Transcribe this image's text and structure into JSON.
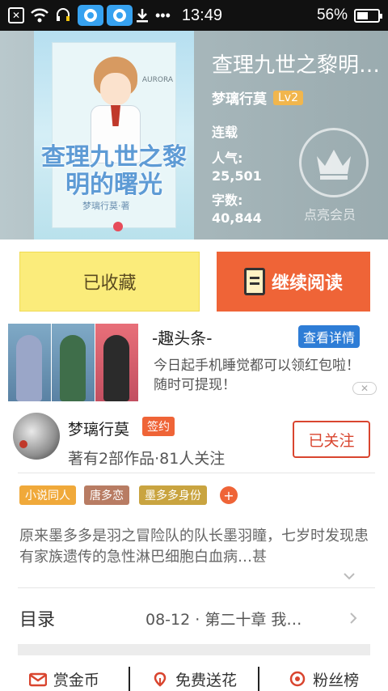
{
  "status_bar": {
    "time": "13:49",
    "battery_percent": "56%",
    "battery_level": 0.56,
    "icons": [
      "sim-blocked-icon",
      "wifi-icon",
      "headset-icon",
      "eye-app-icon",
      "eye-app-icon",
      "download-icon",
      "more-dots-icon"
    ]
  },
  "book": {
    "title": "查理九世之黎明…",
    "cover_title": "查理九世之黎明的曙光",
    "cover_author": "梦璃行莫·著",
    "cover_brand": "AURORA",
    "author": "梦璃行莫",
    "level": "Lv2",
    "status": "连载",
    "popularity_label": "人气:",
    "popularity_value": "25,501",
    "word_count_label": "字数:",
    "word_count_value": "40,844",
    "vip_label": "点亮会员"
  },
  "actions": {
    "favorited": "已收藏",
    "continue_reading": "继续阅读"
  },
  "ad": {
    "title": "-趣头条-",
    "detail_button": "查看详情",
    "description": "今日起手机睡觉都可以领红包啦！随时可提现！",
    "close": "✕"
  },
  "author_card": {
    "name": "梦璃行莫",
    "badge": "签约",
    "stats": "著有2部作品·81人关注",
    "follow_button": "已关注"
  },
  "tags": [
    {
      "label": "小说同人",
      "color": "#f0a93a"
    },
    {
      "label": "唐多恋",
      "color": "#b87c63"
    },
    {
      "label": "墨多多身份",
      "color": "#c9a440"
    }
  ],
  "tag_add": "+",
  "synopsis": "原来墨多多是羽之冒险队的队长墨羽瞳，七岁时发现患有家族遗传的急性淋巴细胞白血病…甚",
  "toc": {
    "label": "目录",
    "latest": "08-12 · 第二十章  我…"
  },
  "bottom_bar": [
    {
      "label": "赏金币",
      "icon": "envelope-icon"
    },
    {
      "label": "免费送花",
      "icon": "flower-icon"
    },
    {
      "label": "粉丝榜",
      "icon": "ranking-icon"
    }
  ],
  "colors": {
    "accent": "#ef6437",
    "favorite_bg": "#fbec7b",
    "ad_button": "#2e7dd6"
  }
}
